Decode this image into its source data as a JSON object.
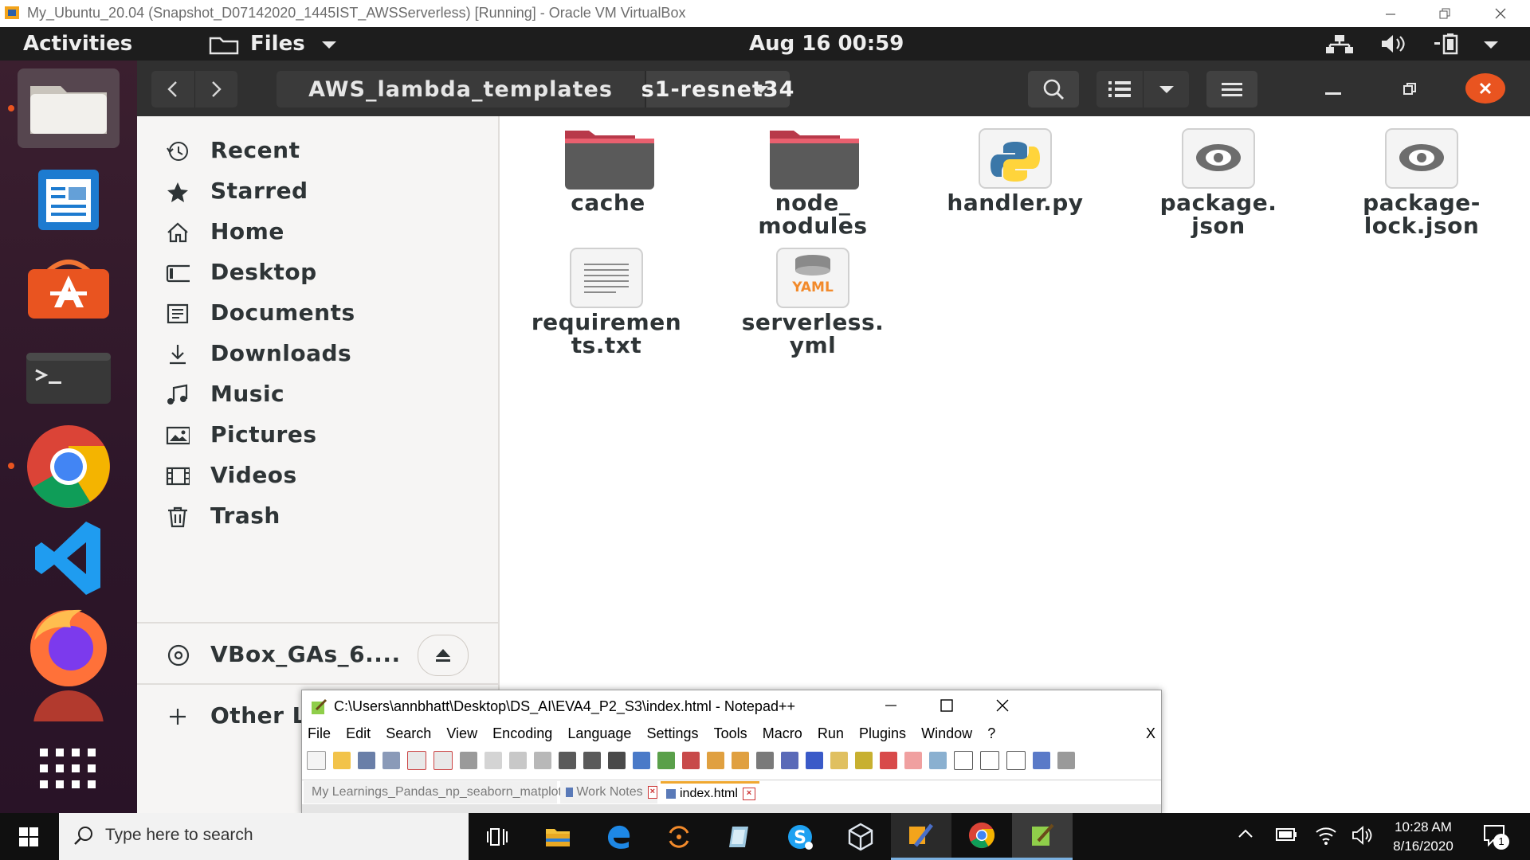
{
  "vbox_window": {
    "title": "My_Ubuntu_20.04 (Snapshot_D07142020_1445IST_AWSServerless) [Running] - Oracle VM VirtualBox"
  },
  "gnome_topbar": {
    "activities": "Activities",
    "app_menu": "Files",
    "clock": "Aug 16  00:59"
  },
  "nautilus": {
    "breadcrumb": {
      "parent": "AWS_lambda_templates",
      "current": "s1-resnet34"
    },
    "sidebar": [
      {
        "label": "Recent",
        "icon": "clock-icon"
      },
      {
        "label": "Starred",
        "icon": "star-icon"
      },
      {
        "label": "Home",
        "icon": "home-icon"
      },
      {
        "label": "Desktop",
        "icon": "desktop-icon"
      },
      {
        "label": "Documents",
        "icon": "documents-icon"
      },
      {
        "label": "Downloads",
        "icon": "download-icon"
      },
      {
        "label": "Music",
        "icon": "music-icon"
      },
      {
        "label": "Pictures",
        "icon": "pictures-icon"
      },
      {
        "label": "Videos",
        "icon": "videos-icon"
      },
      {
        "label": "Trash",
        "icon": "trash-icon"
      }
    ],
    "device": "VBox_GAs_6....",
    "other_locations": "Other L",
    "files": [
      {
        "l1": "cache",
        "l2": "",
        "type": "folder"
      },
      {
        "l1": "node_",
        "l2": "modules",
        "type": "folder"
      },
      {
        "l1": "handler.py",
        "l2": "",
        "type": "python"
      },
      {
        "l1": "package.",
        "l2": "json",
        "type": "json"
      },
      {
        "l1": "package-",
        "l2": "lock.json",
        "type": "json"
      },
      {
        "l1": "requiremen",
        "l2": "ts.txt",
        "type": "text"
      },
      {
        "l1": "serverless.",
        "l2": "yml",
        "type": "yaml"
      }
    ]
  },
  "notepadpp": {
    "title": "C:\\Users\\annbhatt\\Desktop\\DS_AI\\EVA4_P2_S3\\index.html - Notepad++",
    "menu": [
      "File",
      "Edit",
      "Search",
      "View",
      "Encoding",
      "Language",
      "Settings",
      "Tools",
      "Macro",
      "Run",
      "Plugins",
      "Window",
      "?"
    ],
    "menu_close": "X",
    "tabs": [
      {
        "label": "My Learnings_Pandas_np_seaborn_matplot.txt",
        "active": false
      },
      {
        "label": "Work Notes",
        "active": false
      },
      {
        "label": "index.html",
        "active": true
      }
    ]
  },
  "windows_taskbar": {
    "search_placeholder": "Type here to search",
    "time": "10:28 AM",
    "date": "8/16/2020",
    "notification_count": "1"
  }
}
